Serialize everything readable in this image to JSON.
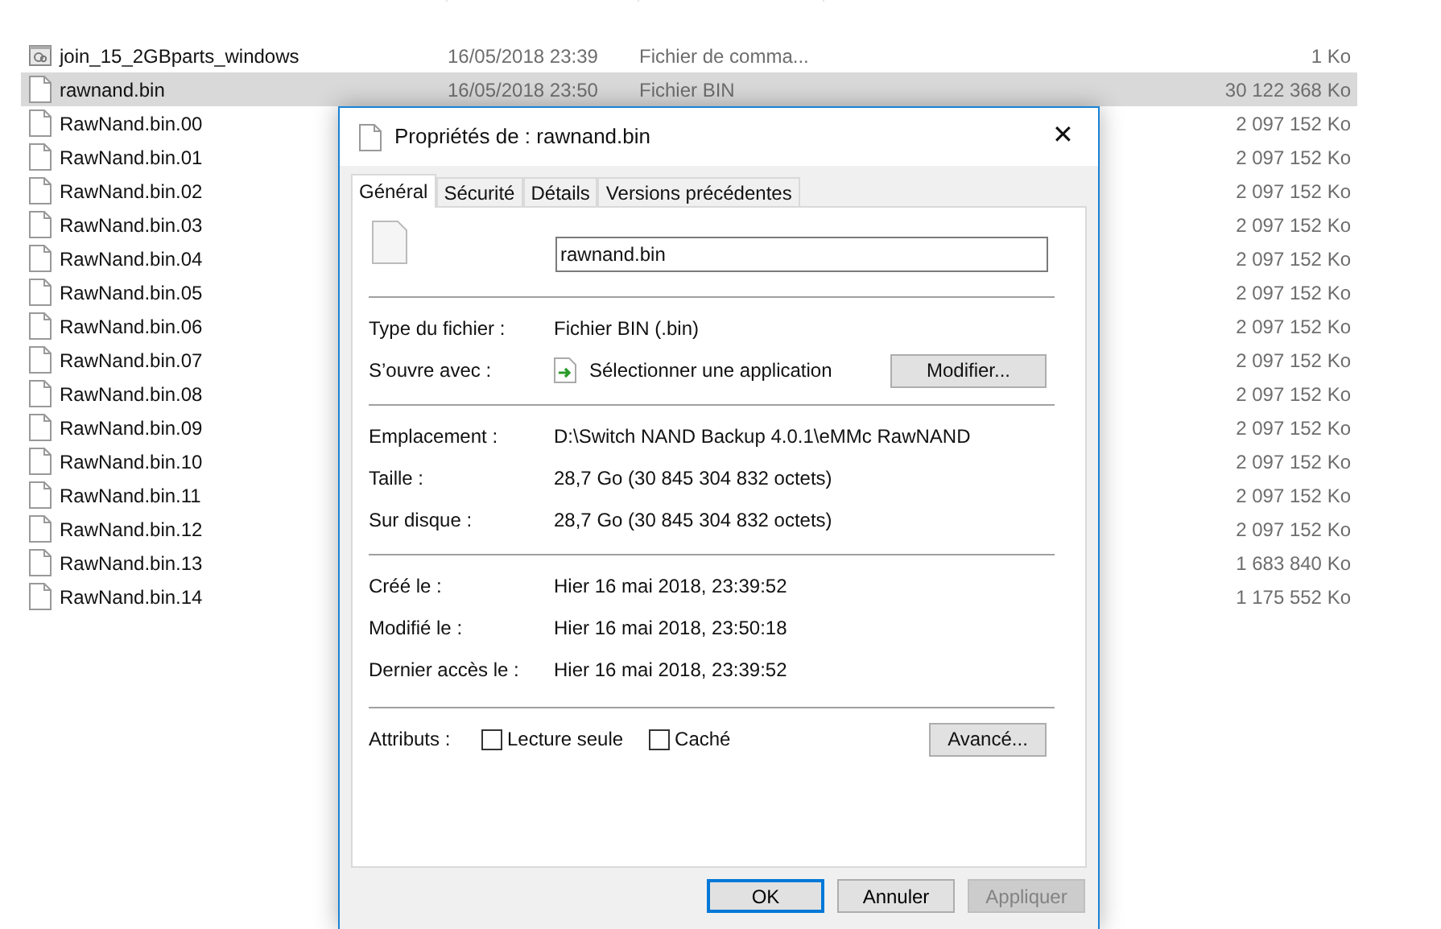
{
  "explorer": {
    "files": [
      {
        "name": "join_15_2GBparts_windows",
        "kind": "script",
        "modified": "16/05/2018 23:39",
        "type": "Fichier de comma...",
        "size": "1 Ko",
        "selected": false
      },
      {
        "name": "rawnand.bin",
        "kind": "file",
        "modified": "16/05/2018 23:50",
        "type": "Fichier BIN",
        "size": "30 122 368 Ko",
        "selected": true
      },
      {
        "name": "RawNand.bin.00",
        "kind": "file",
        "size": "2 097 152 Ko",
        "selected": false
      },
      {
        "name": "RawNand.bin.01",
        "kind": "file",
        "size": "2 097 152 Ko",
        "selected": false
      },
      {
        "name": "RawNand.bin.02",
        "kind": "file",
        "size": "2 097 152 Ko",
        "selected": false
      },
      {
        "name": "RawNand.bin.03",
        "kind": "file",
        "size": "2 097 152 Ko",
        "selected": false
      },
      {
        "name": "RawNand.bin.04",
        "kind": "file",
        "size": "2 097 152 Ko",
        "selected": false
      },
      {
        "name": "RawNand.bin.05",
        "kind": "file",
        "size": "2 097 152 Ko",
        "selected": false
      },
      {
        "name": "RawNand.bin.06",
        "kind": "file",
        "size": "2 097 152 Ko",
        "selected": false
      },
      {
        "name": "RawNand.bin.07",
        "kind": "file",
        "size": "2 097 152 Ko",
        "selected": false
      },
      {
        "name": "RawNand.bin.08",
        "kind": "file",
        "size": "2 097 152 Ko",
        "selected": false
      },
      {
        "name": "RawNand.bin.09",
        "kind": "file",
        "size": "2 097 152 Ko",
        "selected": false
      },
      {
        "name": "RawNand.bin.10",
        "kind": "file",
        "size": "2 097 152 Ko",
        "selected": false
      },
      {
        "name": "RawNand.bin.11",
        "kind": "file",
        "size": "2 097 152 Ko",
        "selected": false
      },
      {
        "name": "RawNand.bin.12",
        "kind": "file",
        "size": "2 097 152 Ko",
        "selected": false
      },
      {
        "name": "RawNand.bin.13",
        "kind": "file",
        "size": "1 683 840 Ko",
        "selected": false
      },
      {
        "name": "RawNand.bin.14",
        "kind": "file",
        "size": "1 175 552 Ko",
        "selected": false
      }
    ]
  },
  "dialog": {
    "title": "Propriétés de : rawnand.bin",
    "close": "✕",
    "tabs": [
      {
        "label": "Général",
        "selected": true
      },
      {
        "label": "Sécurité",
        "selected": false
      },
      {
        "label": "Détails",
        "selected": false
      },
      {
        "label": "Versions précédentes",
        "selected": false
      }
    ],
    "filename": "rawnand.bin",
    "sections": [
      [
        {
          "label": "Type du fichier :",
          "value": "Fichier BIN (.bin)"
        },
        {
          "label": "S’ouvre avec :",
          "value": "Sélectionner une application",
          "button": "Modifier..."
        }
      ],
      [
        {
          "label": "Emplacement :",
          "value": "D:\\Switch NAND Backup 4.0.1\\eMMc RawNAND"
        },
        {
          "label": "Taille :",
          "value": "28,7 Go (30 845 304 832 octets)"
        },
        {
          "label": "Sur disque :",
          "value": "28,7 Go (30 845 304 832 octets)"
        }
      ],
      [
        {
          "label": "Créé le :",
          "value": "Hier 16 mai 2018, 23:39:52"
        },
        {
          "label": "Modifié le :",
          "value": "Hier 16 mai 2018, 23:50:18"
        },
        {
          "label": "Dernier accès le :",
          "value": "Hier 16 mai 2018, 23:39:52"
        }
      ]
    ],
    "attributes": {
      "label": "Attributs :",
      "checkboxes": [
        {
          "label": "Lecture seule",
          "checked": false
        },
        {
          "label": "Caché",
          "checked": false
        }
      ],
      "button": "Avancé..."
    },
    "buttons": [
      {
        "label": "OK",
        "kind": "default"
      },
      {
        "label": "Annuler",
        "kind": "normal"
      },
      {
        "label": "Appliquer",
        "kind": "disabled"
      }
    ]
  }
}
